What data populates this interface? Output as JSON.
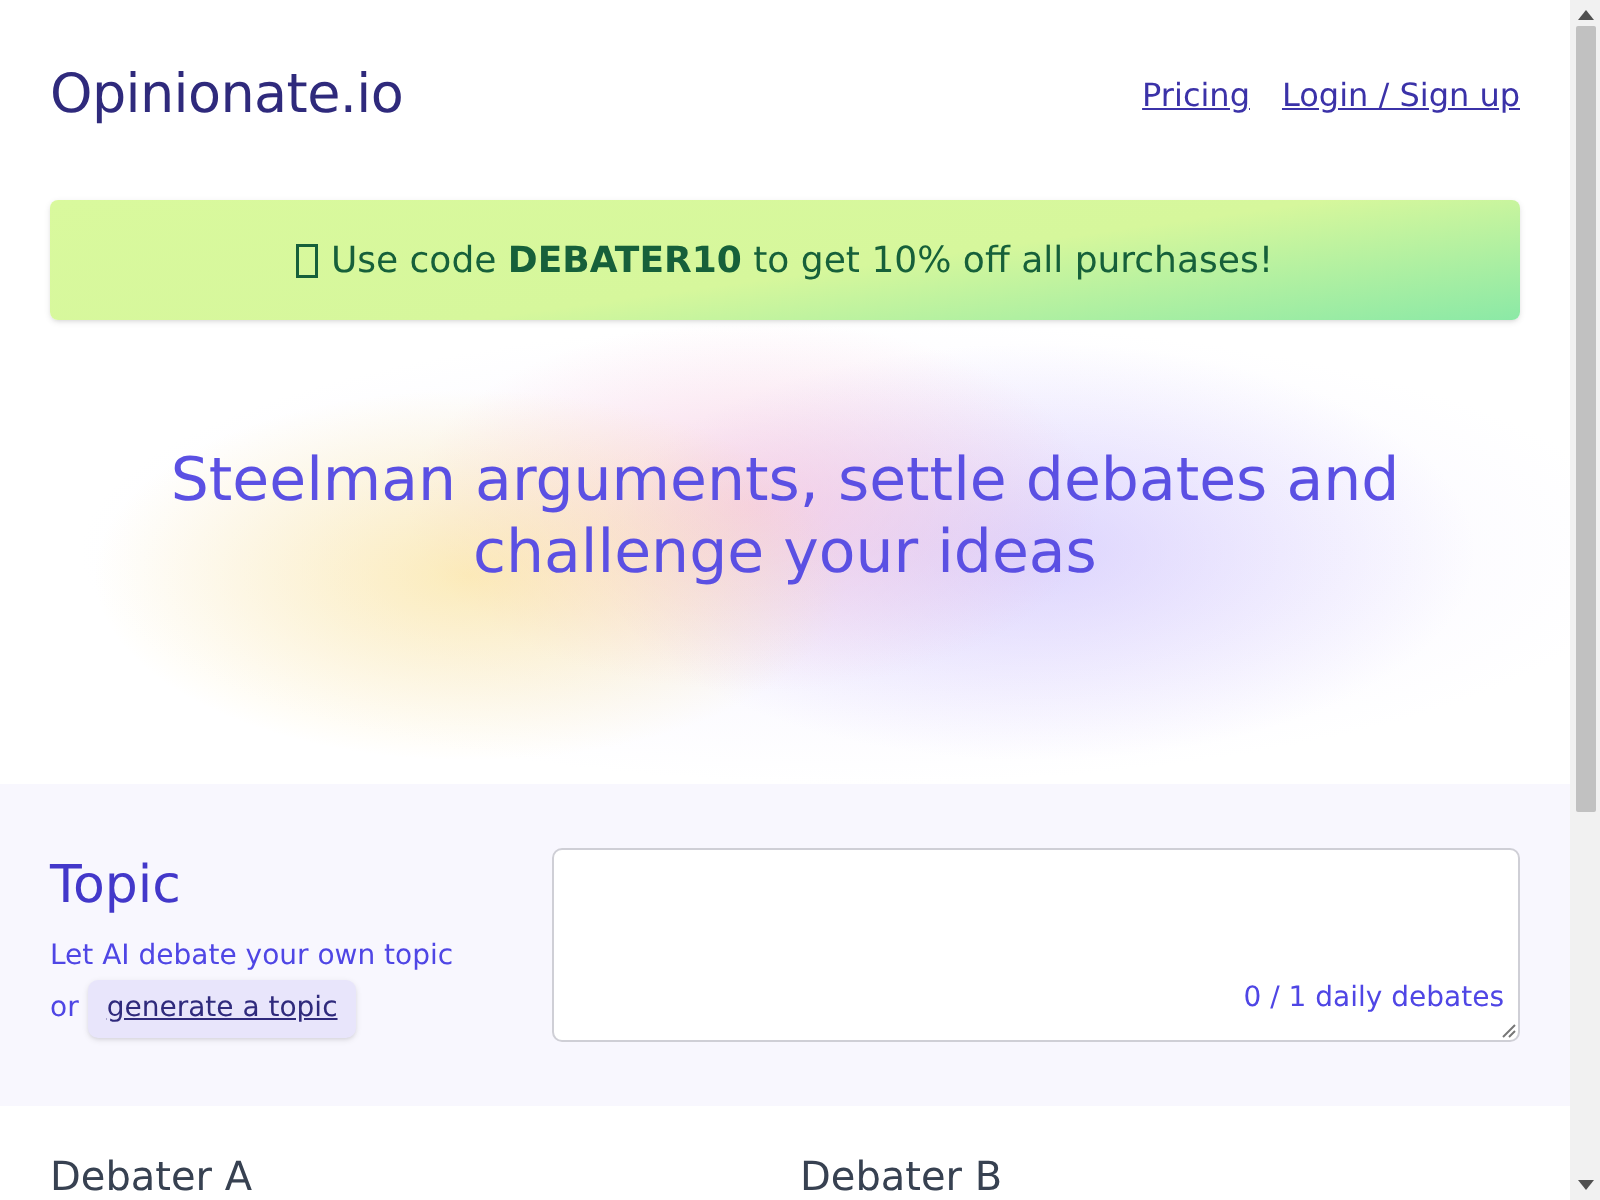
{
  "header": {
    "logo": "Opinionate.io",
    "nav_links": [
      "Pricing",
      "Login / Sign up"
    ]
  },
  "promo_banner": {
    "text": "Use code **DEBATER10** to get 10% off all purchases!"
  },
  "hero": {
    "heading": "Steelman arguments, settle debates and challenge your ideas"
  },
  "topic": {
    "title": "Topic",
    "description": "Let AI debate your own topic",
    "or_label": "or",
    "generate_link": "generate a topic",
    "counter": "0 / 1 daily debates"
  },
  "debaters": [
    {
      "title": "Debater A"
    },
    {
      "title": "Debater B"
    }
  ]
}
